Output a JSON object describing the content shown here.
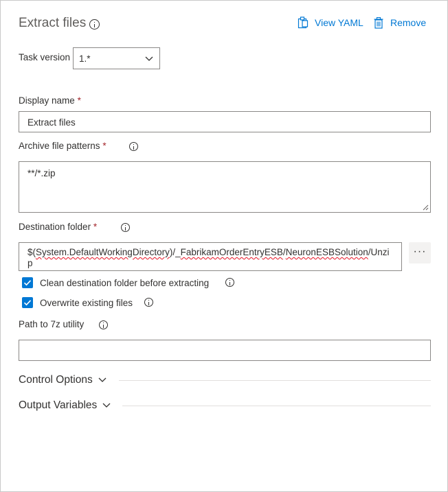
{
  "header": {
    "title": "Extract files",
    "view_yaml_label": "View YAML",
    "remove_label": "Remove"
  },
  "task_version": {
    "label": "Task version",
    "value": "1.*"
  },
  "display_name": {
    "label": "Display name",
    "required_mark": "*",
    "value": "Extract files"
  },
  "archive_patterns": {
    "label": "Archive file patterns",
    "required_mark": "*",
    "value": "**/*.zip"
  },
  "destination_folder": {
    "label": "Destination folder",
    "required_mark": "*",
    "value_line1_prefix": "$(",
    "value_line1_var": "System.DefaultWorkingDirectory",
    "value_line1_mid": ")/_",
    "value_line1_seg2": "FabrikamOrderEntryESB",
    "value_line1_slash": "/",
    "value_line1_seg3": "NeuronESBSolution",
    "value_line1_tail": "/Unzi",
    "value_line2": "p",
    "browse_label": "···"
  },
  "options": [
    {
      "label": "Clean destination folder before extracting",
      "checked": true
    },
    {
      "label": "Overwrite existing files",
      "checked": true
    }
  ],
  "path_7z": {
    "label": "Path to 7z utility",
    "value": ""
  },
  "sections": {
    "control_options": "Control Options",
    "output_variables": "Output Variables"
  },
  "colors": {
    "accent": "#0078d4",
    "required": "#a4262c",
    "text": "#323130"
  }
}
